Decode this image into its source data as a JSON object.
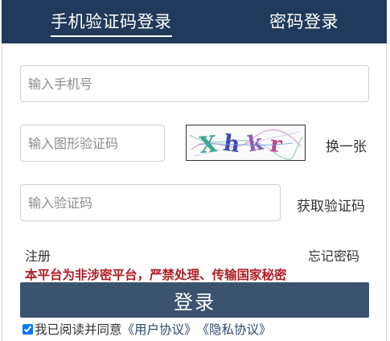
{
  "tabs": {
    "sms_login": "手机验证码登录",
    "password_login": "密码登录"
  },
  "form": {
    "phone_placeholder": "输入手机号",
    "image_code_placeholder": "输入图形验证码",
    "captcha_text": "Xhkr",
    "refresh_captcha": "换一张",
    "sms_code_placeholder": "输入验证码",
    "get_code": "获取验证码",
    "register": "注册",
    "forgot_password": "忘记密码",
    "warning": "本平台为非涉密平台，严禁处理、传输国家秘密",
    "login_button": "登录",
    "agree_text": "我已阅读并同意",
    "user_agreement": "《用户协议》",
    "privacy_agreement": "《隐私协议》",
    "agreed": true
  },
  "colors": {
    "header_bg": "#1f3a5a",
    "button_bg": "#3a536f",
    "warning": "#b01e23",
    "link": "#2c4a6e"
  }
}
